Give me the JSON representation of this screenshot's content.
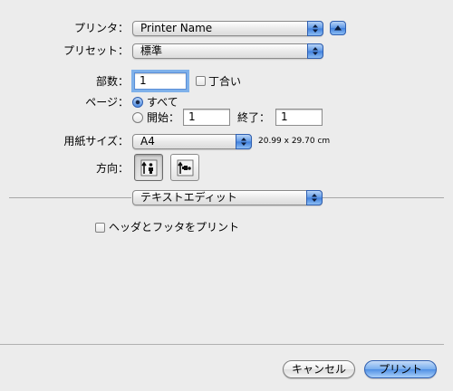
{
  "printer": {
    "label": "プリンタ：",
    "value": "Printer Name"
  },
  "presets": {
    "label": "プリセット：",
    "value": "標準"
  },
  "copies": {
    "label": "部数：",
    "value": "1",
    "collated_label": "丁合い"
  },
  "pages": {
    "label": "ページ：",
    "all_label": "すべて",
    "from_label": "開始：",
    "from_value": "1",
    "to_label": "終了：",
    "to_value": "1"
  },
  "paper_size": {
    "label": "用紙サイズ：",
    "value": "A4",
    "dimensions": "20.99 x 29.70 cm"
  },
  "orientation": {
    "label": "方向："
  },
  "section_popup": {
    "value": "テキストエディット"
  },
  "header_footer": {
    "label": "ヘッダとフッタをプリント"
  },
  "buttons": {
    "cancel": "キャンセル",
    "print": "プリント"
  },
  "icons": {
    "popup_arrow": "updown-arrows-icon",
    "disclosure": "disclosure-up-icon",
    "portrait": "portrait-orientation-icon",
    "landscape": "landscape-orientation-icon"
  }
}
